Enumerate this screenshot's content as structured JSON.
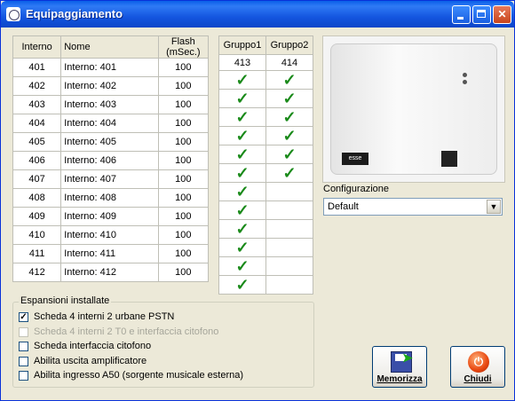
{
  "window": {
    "title": "Equipaggiamento"
  },
  "main_table": {
    "headers": {
      "interno": "Interno",
      "nome": "Nome",
      "flash_line1": "Flash",
      "flash_line2": "(mSec.)"
    },
    "rows": [
      {
        "interno": "401",
        "nome": "Interno: 401",
        "flash": "100"
      },
      {
        "interno": "402",
        "nome": "Interno: 402",
        "flash": "100"
      },
      {
        "interno": "403",
        "nome": "Interno: 403",
        "flash": "100"
      },
      {
        "interno": "404",
        "nome": "Interno: 404",
        "flash": "100"
      },
      {
        "interno": "405",
        "nome": "Interno: 405",
        "flash": "100"
      },
      {
        "interno": "406",
        "nome": "Interno: 406",
        "flash": "100"
      },
      {
        "interno": "407",
        "nome": "Interno: 407",
        "flash": "100"
      },
      {
        "interno": "408",
        "nome": "Interno: 408",
        "flash": "100"
      },
      {
        "interno": "409",
        "nome": "Interno: 409",
        "flash": "100"
      },
      {
        "interno": "410",
        "nome": "Interno: 410",
        "flash": "100"
      },
      {
        "interno": "411",
        "nome": "Interno: 411",
        "flash": "100"
      },
      {
        "interno": "412",
        "nome": "Interno: 412",
        "flash": "100"
      }
    ]
  },
  "group_table": {
    "headers": {
      "g1": "Gruppo1",
      "g2": "Gruppo2"
    },
    "numbers": {
      "g1": "413",
      "g2": "414"
    },
    "rows": [
      {
        "g1": true,
        "g2": true
      },
      {
        "g1": true,
        "g2": true
      },
      {
        "g1": true,
        "g2": true
      },
      {
        "g1": true,
        "g2": true
      },
      {
        "g1": true,
        "g2": true
      },
      {
        "g1": true,
        "g2": true
      },
      {
        "g1": true,
        "g2": false
      },
      {
        "g1": true,
        "g2": false
      },
      {
        "g1": true,
        "g2": false
      },
      {
        "g1": true,
        "g2": false
      },
      {
        "g1": true,
        "g2": false
      },
      {
        "g1": true,
        "g2": false
      }
    ],
    "check_glyph": "✓",
    "check_color": "#1a8a1a"
  },
  "device_image": {
    "logo_text": "esse"
  },
  "configurazione": {
    "label": "Configurazione",
    "selected": "Default"
  },
  "espansioni": {
    "legend": "Espansioni installate",
    "items": [
      {
        "label": "Scheda 4 interni 2 urbane PSTN",
        "checked": true,
        "enabled": true
      },
      {
        "label": "Scheda 4 interni 2 T0 e interfaccia citofono",
        "checked": false,
        "enabled": false
      },
      {
        "label": "Scheda interfaccia citofono",
        "checked": false,
        "enabled": true
      },
      {
        "label": "Abilita uscita amplificatore",
        "checked": false,
        "enabled": true
      },
      {
        "label": "Abilita ingresso A50 (sorgente musicale esterna)",
        "checked": false,
        "enabled": true
      }
    ]
  },
  "buttons": {
    "memorizza": "Memorizza",
    "chiudi": "Chiudi"
  },
  "icons": {
    "app": "app-icon",
    "minimize": "minimize-icon",
    "maximize": "maximize-icon",
    "close": "close-icon",
    "save": "save-disk-icon",
    "power": "power-icon",
    "dropdown": "chevron-down-icon"
  }
}
